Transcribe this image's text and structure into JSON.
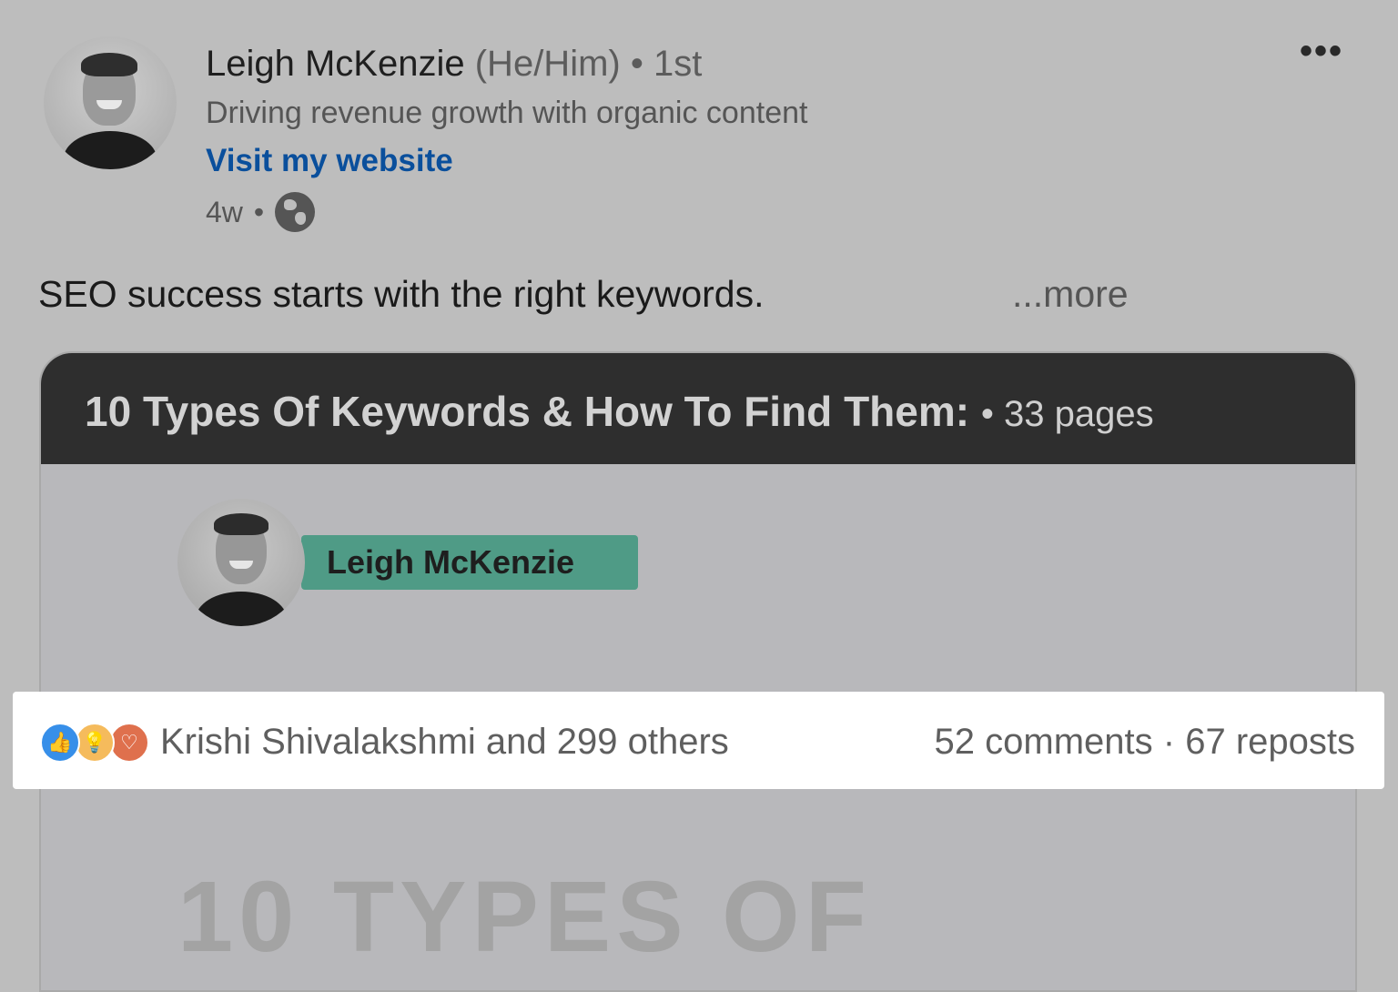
{
  "author": {
    "name": "Leigh McKenzie",
    "pronouns": "(He/Him)",
    "degree": "1st",
    "headline": "Driving revenue growth with organic content",
    "website_link": "Visit my website",
    "time_ago": "4w",
    "visibility_icon": "globe-icon"
  },
  "menu": {
    "label": "•••"
  },
  "post": {
    "text": "SEO success starts with the right keywords.",
    "more": "...more"
  },
  "document": {
    "title": "10 Types Of Keywords & How To Find Them:",
    "pages": "33 pages",
    "name_tag": "Leigh McKenzie",
    "cover_text": "10 TYPES OF"
  },
  "social": {
    "reaction_icons": [
      "like-icon",
      "insightful-icon",
      "love-icon"
    ],
    "reactors": "Krishi Shivalakshmi and 299 others",
    "comments": "52 comments",
    "separator": "·",
    "reposts": "67 reposts"
  },
  "colors": {
    "link": "#0a4f9c",
    "name_tag": "#4f9b86",
    "doc_header": "#2e2e2e",
    "like": "#378fe9",
    "insightful": "#f5bb5c",
    "love": "#df704d"
  }
}
